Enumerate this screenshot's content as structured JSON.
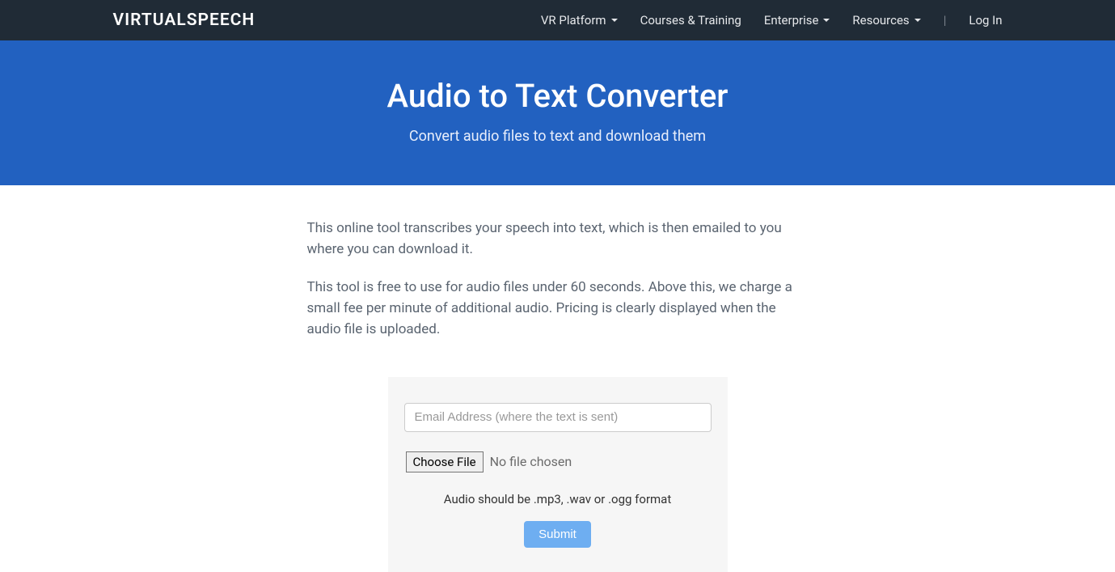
{
  "brand": "VIRTUALSPEECH",
  "nav": {
    "vr_platform": "VR Platform",
    "courses": "Courses & Training",
    "enterprise": "Enterprise",
    "resources": "Resources",
    "separator": "|",
    "login": "Log In"
  },
  "hero": {
    "title": "Audio to Text Converter",
    "subtitle": "Convert audio files to text and download them"
  },
  "content": {
    "para1": "This online tool transcribes your speech into text, which is then emailed to you where you can download it.",
    "para2": "This tool is free to use for audio files under 60 seconds. Above this, we charge a small fee per minute of additional audio. Pricing is clearly displayed when the audio file is uploaded."
  },
  "form": {
    "email_placeholder": "Email Address (where the text is sent)",
    "choose_file_label": "Choose File",
    "no_file_text": "No file chosen",
    "format_hint": "Audio should be .mp3, .wav or .ogg format",
    "submit_label": "Submit"
  }
}
